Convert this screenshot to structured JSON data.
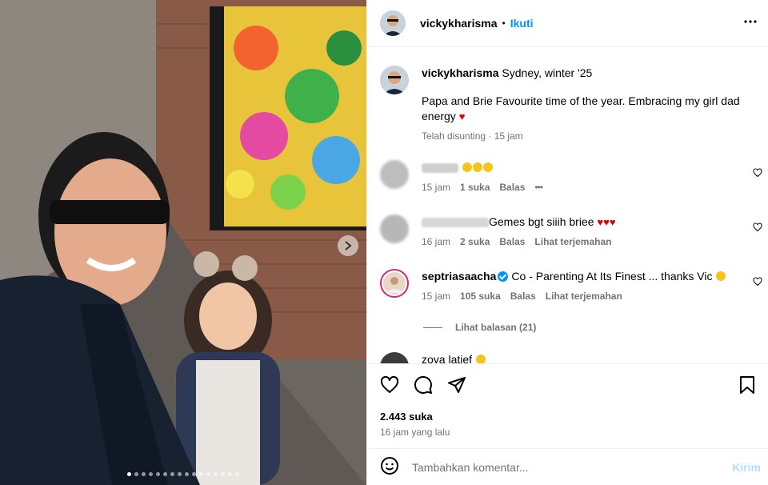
{
  "colors": {
    "accent": "#0095f6",
    "muted": "#737373",
    "heart": "#d00000"
  },
  "carousel": {
    "dot_count": 16,
    "active_index": 0
  },
  "header": {
    "username": "vickykharisma",
    "separator": "•",
    "follow_label": "Ikuti"
  },
  "caption": {
    "username": "vickykharisma",
    "location": "Sydney, winter '25",
    "text": "Papa and Brie Favourite time of the year. Embracing my girl dad energy",
    "edited": "Telah disunting",
    "time_sep": "·",
    "time": "15 jam"
  },
  "comments": [
    {
      "text_suffix": "",
      "time": "15 jam",
      "likes": "1 suka",
      "reply": "Balas",
      "more": "•••"
    },
    {
      "text": "Gemes bgt siiih briee",
      "hearts": "♥♥♥",
      "time": "16 jam",
      "likes": "2 suka",
      "reply": "Balas",
      "translate": "Lihat terjemahan"
    },
    {
      "username": "septriasaacha",
      "text": "Co - Parenting At Its Finest ... thanks Vic",
      "time": "15 jam",
      "likes": "105 suka",
      "reply": "Balas",
      "translate": "Lihat terjemahan",
      "replies": "Lihat balasan (21)"
    },
    {
      "username": "zoya latief"
    }
  ],
  "actions": {
    "likes": "2.443 suka",
    "time": "16 jam yang lalu"
  },
  "composer": {
    "placeholder": "Tambahkan komentar...",
    "post_label": "Kirim"
  },
  "icons": [
    "heart-icon",
    "comment-icon",
    "share-icon",
    "bookmark-icon",
    "more-icon",
    "emoji-icon",
    "chevron-right-icon"
  ]
}
